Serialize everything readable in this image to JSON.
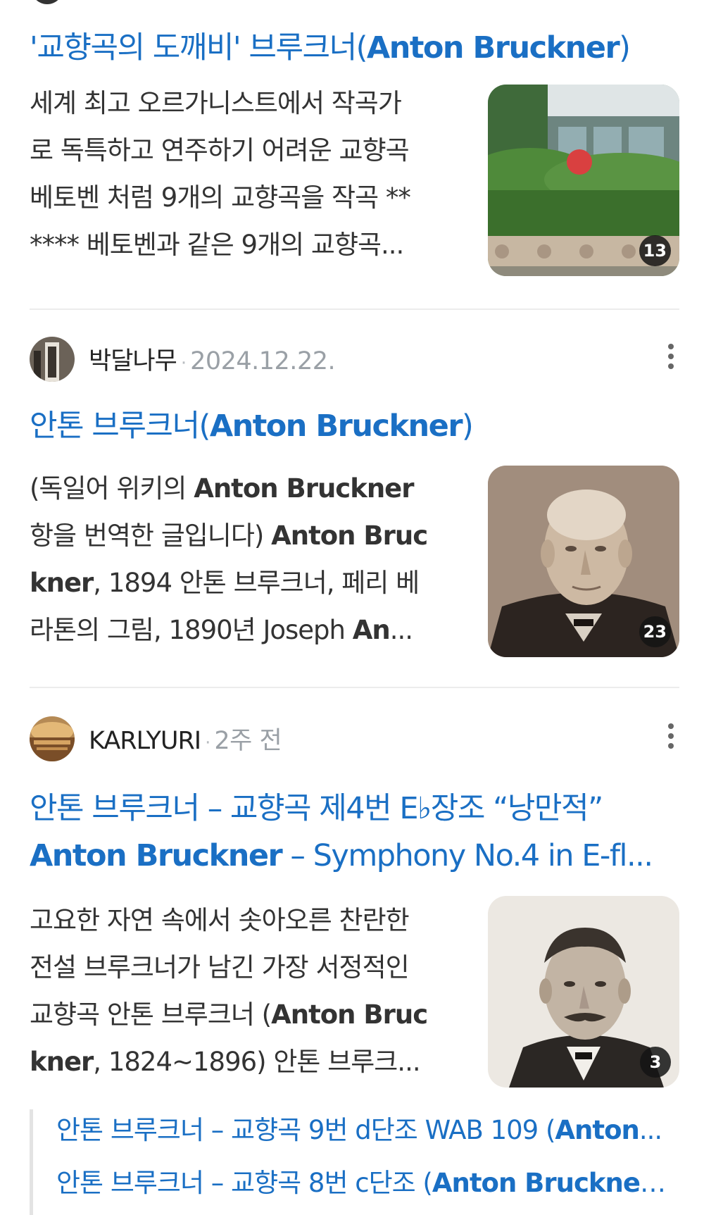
{
  "results": [
    {
      "title_parts": [
        "'교향곡의 도깨비' 브루크너(",
        "Anton Bruckner",
        ")"
      ],
      "snippet_lines": [
        "세계 최고 오르가니스트에서 작곡가",
        "로 독특하고 연주하기 어려운 교향곡",
        "베토벤 처럼 9개의 교향곡을 작곡 **",
        "**** 베토벤과 같은 9개의 교향곡..."
      ],
      "thumb_count": "13",
      "thumb_subject": "garden-building-photo"
    },
    {
      "author": "박달나무",
      "separator": "·",
      "date": "2024.12.22.",
      "title_parts": [
        "안톤 브루크너(",
        "Anton Bruckner",
        ")"
      ],
      "snippet_lines": [
        [
          "(독일어 위키의 ",
          "Anton Bruckner",
          ""
        ],
        [
          "항을 번역한 글입니다) ",
          "Anton Bruc",
          ""
        ],
        [
          "",
          "kner",
          ", 1894 안톤 브루크너, 페리 베"
        ],
        [
          "라톤의 그림, 1890년 Joseph ",
          "An",
          "..."
        ]
      ],
      "thumb_count": "23",
      "thumb_subject": "bruckner-elderly-portrait"
    },
    {
      "author": "KARLYURI",
      "separator": "·",
      "date": "2주 전",
      "title_line1": "안톤 브루크너 – 교향곡 제4번 E♭장조 “낭만적”",
      "title_line2_parts": [
        "",
        "Anton Bruckner",
        " – Symphony No.4 in E-fl..."
      ],
      "snippet_lines": [
        [
          "고요한 자연 속에서 솟아오른 찬란한",
          "",
          ""
        ],
        [
          "전설 브루크너가 남긴 가장 서정적인",
          "",
          ""
        ],
        [
          "교향곡 안톤 브루크너 (",
          "Anton Bruc",
          ""
        ],
        [
          "",
          "kner",
          ", 1824~1896) 안톤 브루크..."
        ]
      ],
      "thumb_count": "3",
      "thumb_subject": "bruckner-mustache-portrait",
      "sublinks": [
        [
          "안톤 브루크너 – 교향곡 9번 d단조 WAB 109 (",
          "Anton",
          "..."
        ],
        [
          "안톤 브루크너 – 교향곡 8번 c단조 (",
          "Anton Bruckner",
          ",..."
        ]
      ]
    }
  ],
  "colors": {
    "link": "#1a6fc4",
    "text": "#333333",
    "meta": "#9aa0a6"
  },
  "icons": {
    "more": "more-vertical-icon"
  }
}
